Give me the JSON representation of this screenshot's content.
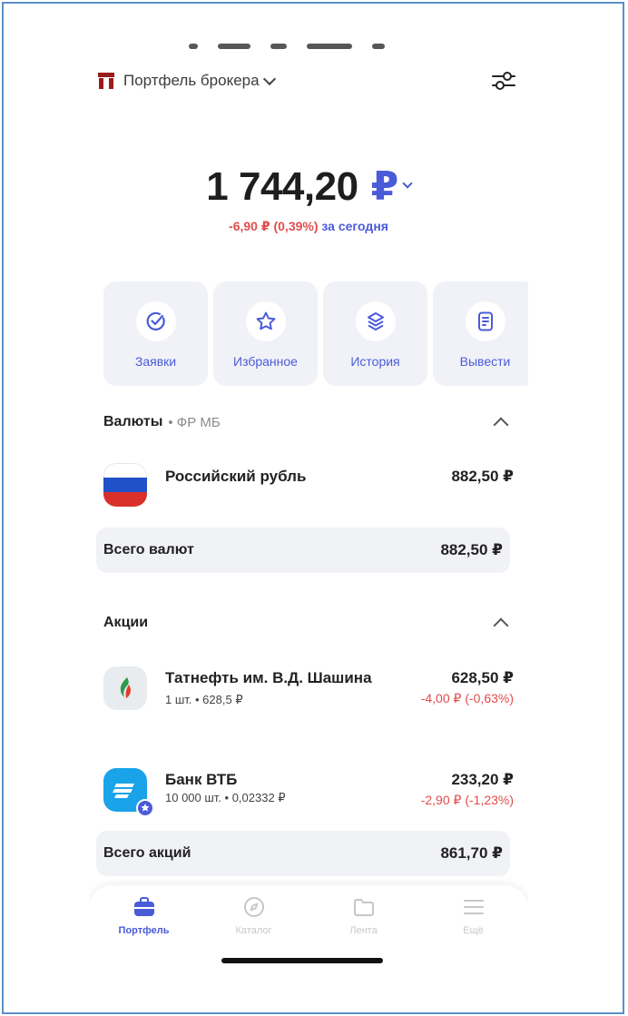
{
  "colors": {
    "accent": "#4a5bd8",
    "negative": "#e24c4c",
    "card_bg": "#f1f2f8",
    "broker_red": "#9a1b1b"
  },
  "header": {
    "portfolio_title": "Портфель брокера",
    "icon_filters": "sliders-icon"
  },
  "balance": {
    "amount": "1 744,20",
    "currency": "₽",
    "daily_change": "-6,90 ₽ (0,39%)",
    "daily_label": "за сегодня"
  },
  "actions": [
    {
      "label": "Заявки",
      "icon": "check-circle-icon"
    },
    {
      "label": "Избранное",
      "icon": "star-icon"
    },
    {
      "label": "История",
      "icon": "layers-icon"
    },
    {
      "label": "Вывести",
      "icon": "document-icon"
    }
  ],
  "currencies": {
    "title": "Валюты",
    "subtitle": "• ФР МБ",
    "items": [
      {
        "name": "Российский рубль",
        "value": "882,50 ₽"
      }
    ],
    "total_label": "Всего валют",
    "total_value": "882,50 ₽"
  },
  "stocks": {
    "title": "Акции",
    "items": [
      {
        "name": "Татнефть им. В.Д. Шашина",
        "meta": "1 шт. • 628,5 ₽",
        "value": "628,50 ₽",
        "change": "-4,00 ₽ (-0,63%)"
      },
      {
        "name": "Банк ВТБ",
        "meta": "10 000 шт. • 0,02332 ₽",
        "value": "233,20 ₽",
        "change": "-2,90 ₽ (-1,23%)"
      }
    ],
    "total_label": "Всего акций",
    "total_value": "861,70 ₽"
  },
  "tabbar": {
    "tabs": [
      {
        "label": "Портфель",
        "icon": "briefcase-icon",
        "active": true
      },
      {
        "label": "Каталог",
        "icon": "compass-icon",
        "active": false
      },
      {
        "label": "Лента",
        "icon": "folder-icon",
        "active": false
      },
      {
        "label": "Ещё",
        "icon": "menu-icon",
        "active": false
      }
    ]
  }
}
